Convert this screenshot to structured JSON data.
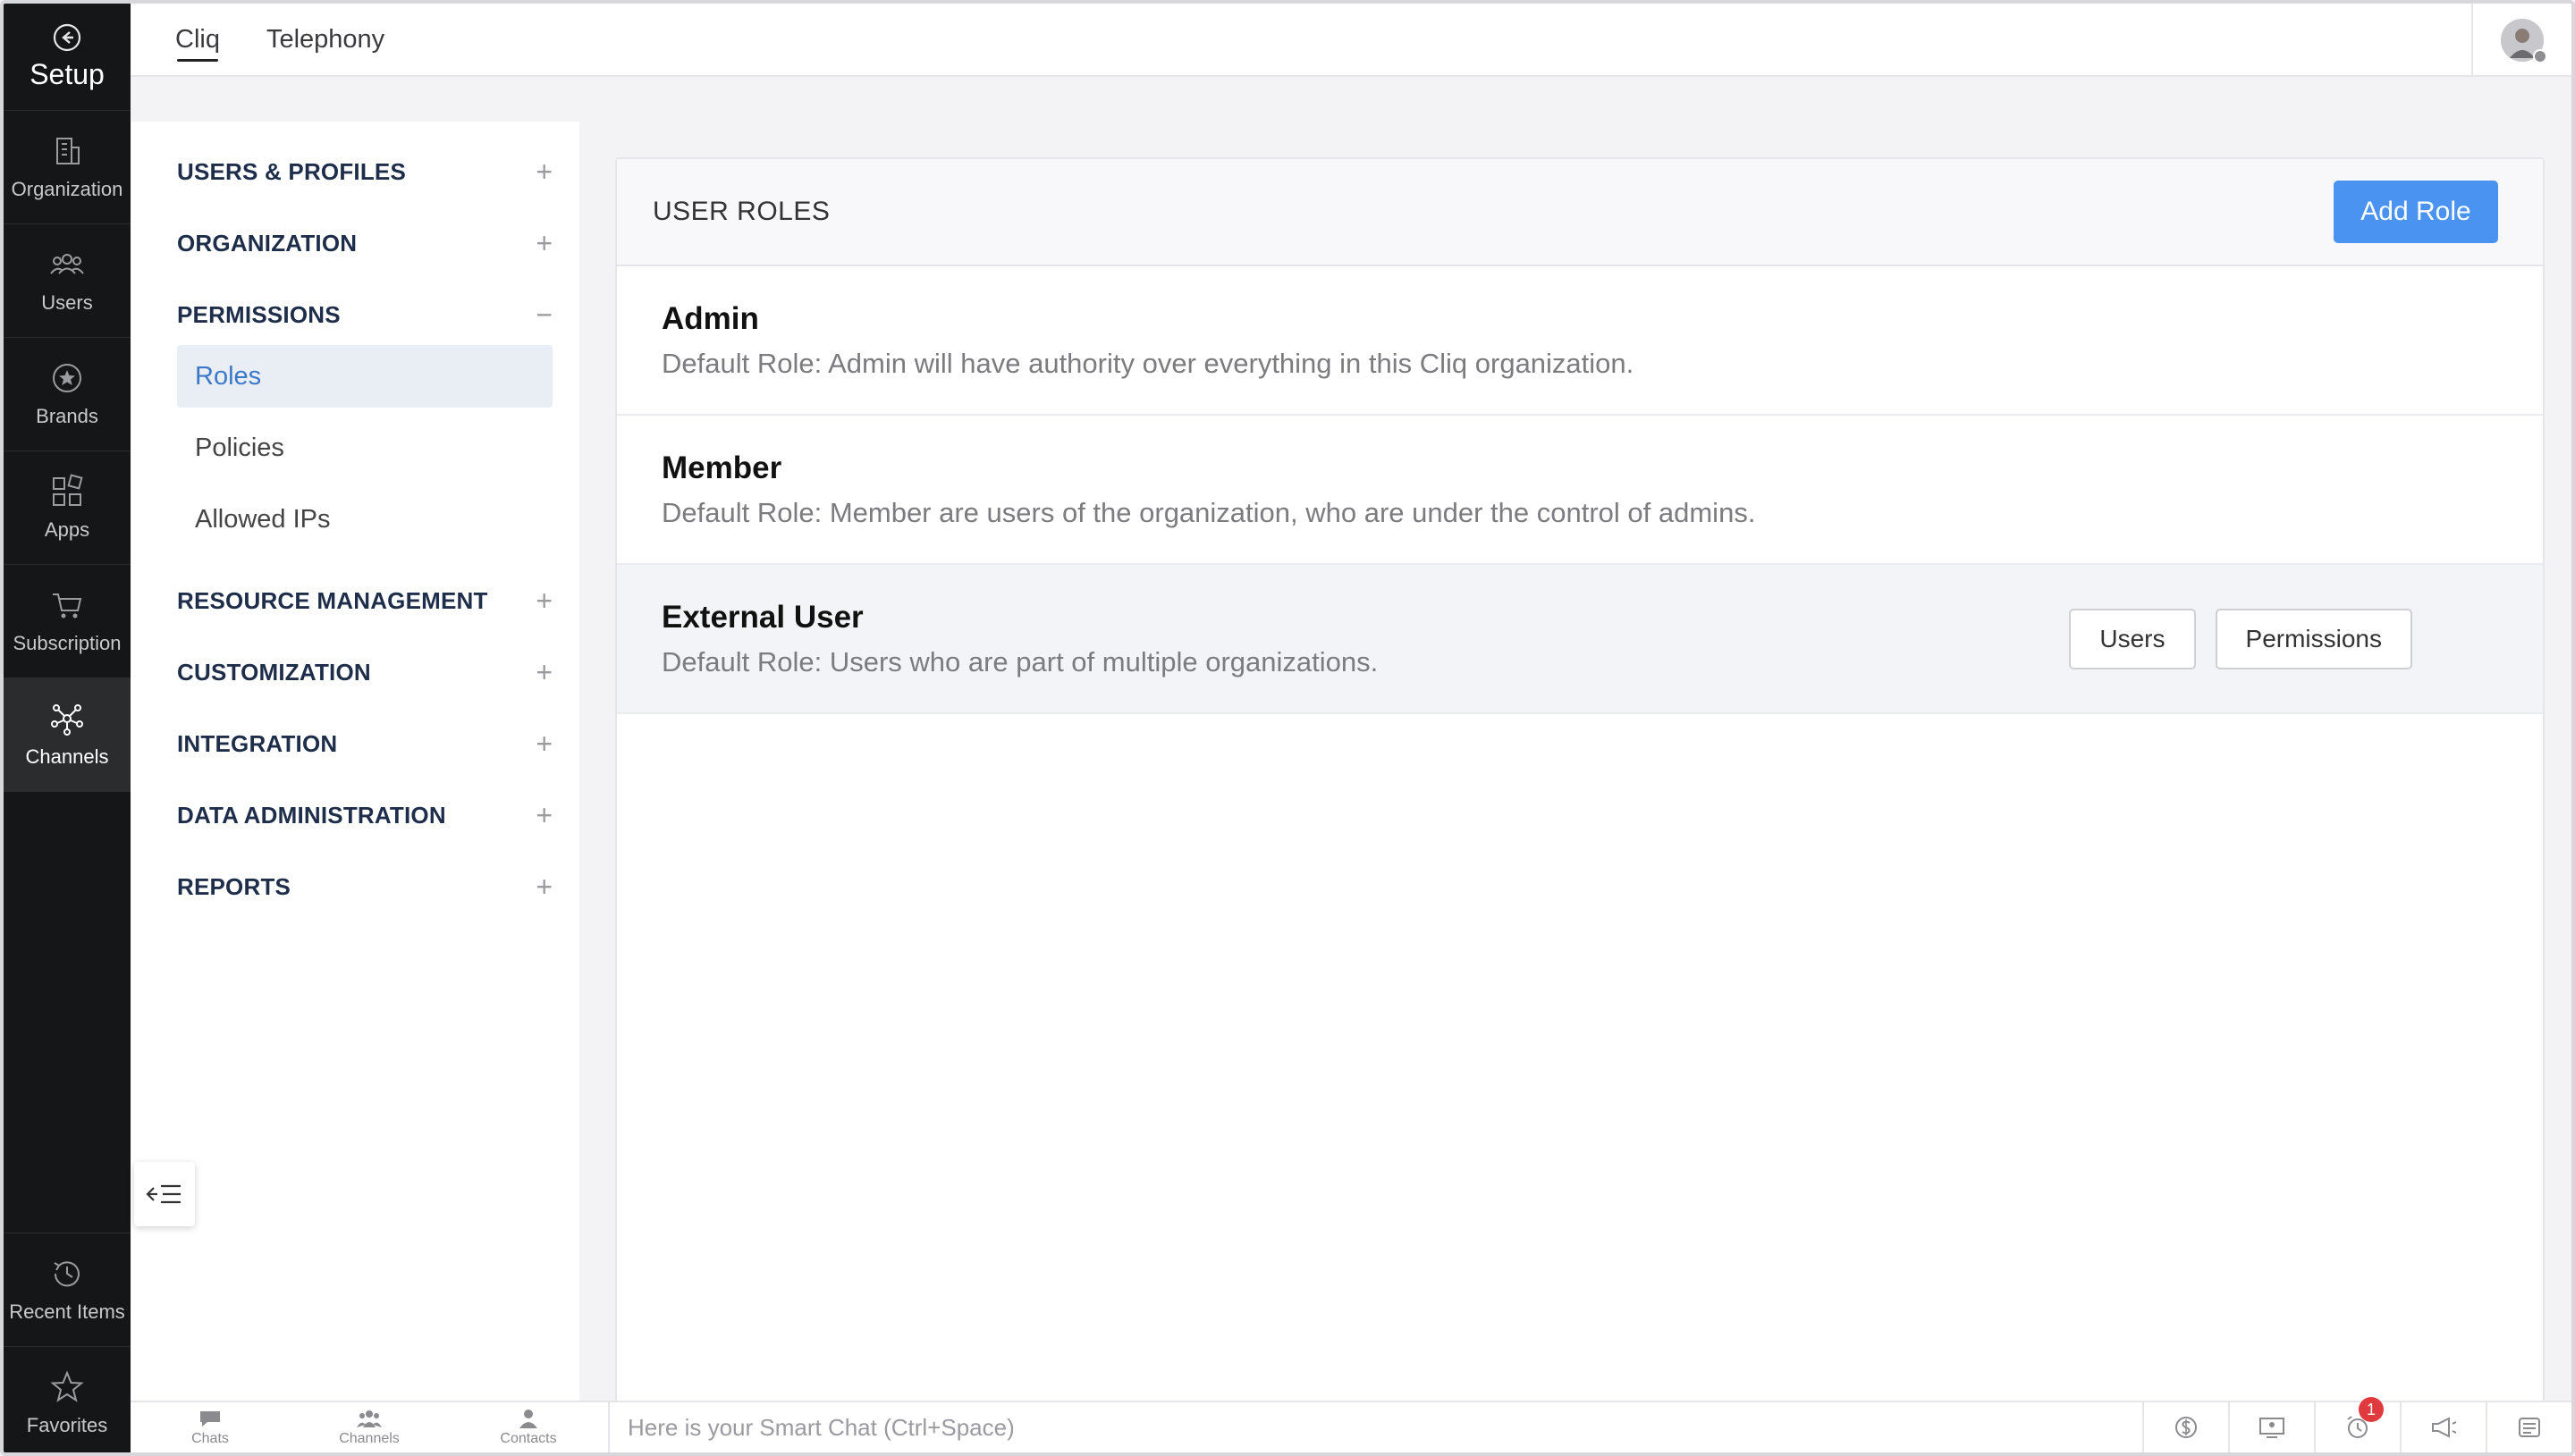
{
  "rail": {
    "title": "Setup",
    "items": [
      {
        "label": "Organization",
        "icon": "building-icon"
      },
      {
        "label": "Users",
        "icon": "users-icon"
      },
      {
        "label": "Brands",
        "icon": "badge-star-icon"
      },
      {
        "label": "Apps",
        "icon": "apps-grid-icon"
      },
      {
        "label": "Subscription",
        "icon": "cart-icon"
      },
      {
        "label": "Channels",
        "icon": "network-icon",
        "active": true
      }
    ],
    "bottom_items": [
      {
        "label": "Recent Items",
        "icon": "history-icon"
      },
      {
        "label": "Favorites",
        "icon": "star-icon"
      }
    ]
  },
  "topbar": {
    "tabs": [
      {
        "label": "Cliq",
        "active": true
      },
      {
        "label": "Telephony",
        "active": false
      }
    ]
  },
  "sidenav": {
    "sections": [
      {
        "label": "USERS & PROFILES",
        "toggle": "+"
      },
      {
        "label": "ORGANIZATION",
        "toggle": "+"
      },
      {
        "label": "PERMISSIONS",
        "toggle": "−"
      },
      {
        "label": "RESOURCE MANAGEMENT",
        "toggle": "+"
      },
      {
        "label": "CUSTOMIZATION",
        "toggle": "+"
      },
      {
        "label": "INTEGRATION",
        "toggle": "+"
      },
      {
        "label": "DATA ADMINISTRATION",
        "toggle": "+"
      },
      {
        "label": "REPORTS",
        "toggle": "+"
      }
    ],
    "permissions_items": [
      {
        "label": "Roles",
        "active": true
      },
      {
        "label": "Policies",
        "active": false
      },
      {
        "label": "Allowed IPs",
        "active": false
      }
    ]
  },
  "panel": {
    "title": "USER ROLES",
    "add_button": "Add Role",
    "roles": [
      {
        "name": "Admin",
        "description": "Default Role: Admin will have authority over everything in this Cliq organization."
      },
      {
        "name": "Member",
        "description": "Default Role: Member are users of the organization, who are under the control of admins."
      },
      {
        "name": "External User",
        "description": "Default Role: Users who are part of multiple organizations."
      }
    ],
    "row_actions": {
      "users": "Users",
      "permissions": "Permissions"
    }
  },
  "bottombar": {
    "tabs": [
      {
        "label": "Chats",
        "icon": "chat-bubble-icon"
      },
      {
        "label": "Channels",
        "icon": "group-icon"
      },
      {
        "label": "Contacts",
        "icon": "contact-icon"
      }
    ],
    "smartchat_placeholder": "Here is your Smart Chat (Ctrl+Space)",
    "icons": [
      "money-icon",
      "screen-share-icon",
      "reminder-icon",
      "announcement-icon",
      "notes-icon"
    ],
    "reminder_badge": "1"
  },
  "colors": {
    "accent": "#4b93f0",
    "rail_bg": "#151617",
    "active_nav_bg": "#e9eef5",
    "active_nav_text": "#3b78c9"
  }
}
